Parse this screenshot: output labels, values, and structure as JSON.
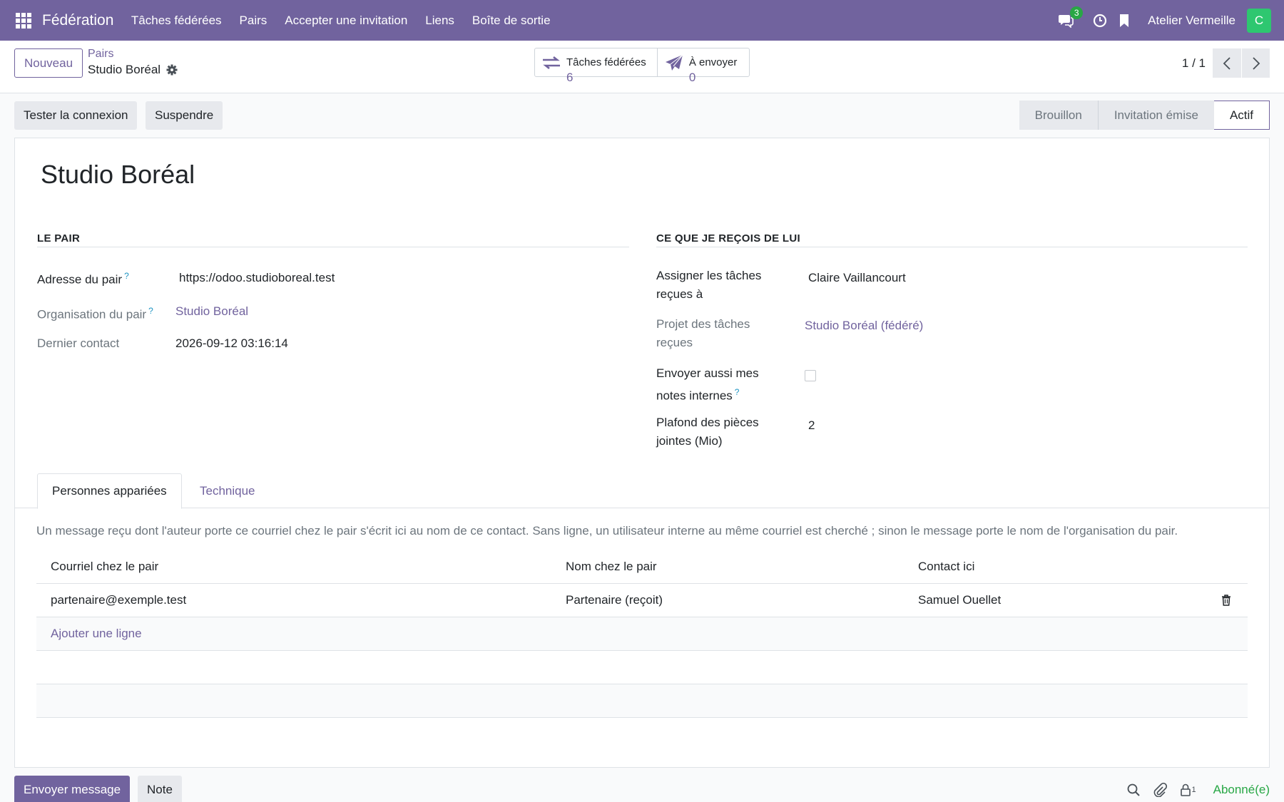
{
  "navbar": {
    "app_title": "Fédération",
    "menu": [
      "Tâches fédérées",
      "Pairs",
      "Accepter une invitation",
      "Liens",
      "Boîte de sortie"
    ],
    "messages_count": "3",
    "company": "Atelier Vermeille",
    "avatar_letter": "C",
    "colors": {
      "bar": "#71639e",
      "avatar": "#2ec770",
      "badge": "#28a745"
    }
  },
  "control_panel": {
    "new_label": "Nouveau",
    "breadcrumb_parent": "Pairs",
    "breadcrumb_current": "Studio Boréal",
    "smart_buttons": [
      {
        "icon": "arrows-exchange-icon",
        "label": "Tâches fédérées",
        "value": "6"
      },
      {
        "icon": "paper-plane-icon",
        "label": "À envoyer",
        "value": "0"
      }
    ],
    "pager": "1 / 1"
  },
  "actions": {
    "test_connection": "Tester la connexion",
    "suspend": "Suspendre"
  },
  "statusbar": {
    "stages": [
      "Brouillon",
      "Invitation émise",
      "Actif"
    ],
    "active": "Actif"
  },
  "record": {
    "title": "Studio Boréal",
    "section_peer": "Le pair",
    "section_receive": "Ce que je reçois de lui",
    "peer_address_label": "Adresse du pair",
    "peer_address": "https://odoo.studioboreal.test",
    "peer_org_label": "Organisation du pair",
    "peer_org": "Studio Boréal",
    "last_contact_label": "Dernier contact",
    "last_contact": "2026-09-12 03:16:14",
    "assign_label_1": "Assigner les tâches",
    "assign_label_2": "reçues à",
    "assign_value": "Claire Vaillancourt",
    "project_label_1": "Projet des tâches",
    "project_label_2": "reçues",
    "project_value": "Studio Boréal (fédéré)",
    "send_notes_label_1": "Envoyer aussi mes",
    "send_notes_label_2": "notes internes",
    "send_notes_checked": false,
    "attach_label_1": "Plafond des pièces",
    "attach_label_2": "jointes (Mio)",
    "attach_value": "2",
    "help_mark": "?"
  },
  "tabs": {
    "items": [
      "Personnes appariées",
      "Technique"
    ],
    "active": "Personnes appariées",
    "note": "Un message reçu dont l'auteur porte ce courriel chez le pair s'écrit ici au nom de ce contact. Sans ligne, un utilisateur interne au même courriel est cherché ; sinon le message porte le nom de l'organisation du pair."
  },
  "table": {
    "headers": [
      "Courriel chez le pair",
      "Nom chez le pair",
      "Contact ici"
    ],
    "rows": [
      [
        "partenaire@exemple.test",
        "Partenaire (reçoit)",
        "Samuel Ouellet"
      ]
    ],
    "add_line": "Ajouter une ligne"
  },
  "chatter": {
    "send_message": "Envoyer message",
    "note": "Note",
    "followers_count": "1",
    "subscribed": "Abonné(e)"
  }
}
